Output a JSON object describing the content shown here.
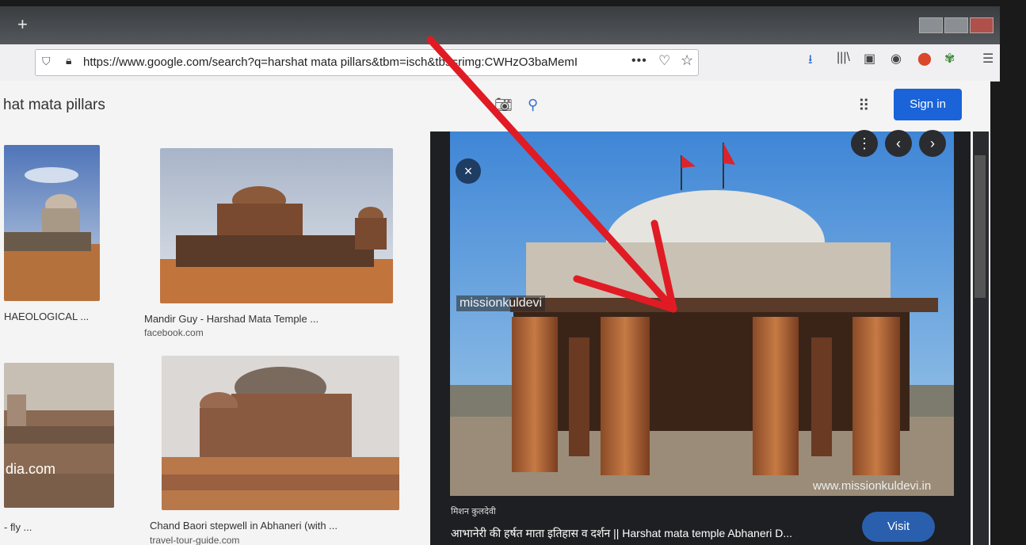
{
  "browser": {
    "new_tab_glyph": "+",
    "url": "https://www.google.com/search?q=harshat mata pillars&tbm=isch&tbs=rimg:CWHzO3baMemI",
    "more_glyph": "•••"
  },
  "google": {
    "query": "hat mata pillars",
    "sign_in_label": "Sign in"
  },
  "results": [
    {
      "caption": "HAEOLOGICAL ...",
      "source": ""
    },
    {
      "caption": "Mandir Guy - Harshad Mata Temple ...",
      "source": "facebook.com"
    },
    {
      "caption": "- fly ...",
      "source": ""
    },
    {
      "caption": "Chand Baori stepwell in Abhaneri (with ...",
      "source": "travel-tour-guide.com"
    }
  ],
  "thumb_overlay_text": "dia.com",
  "preview": {
    "watermark_top": "missionkuldevi",
    "watermark_bottom": "www.missionkuldevi.in",
    "source": "मिशन कुलदेवी",
    "title": "आभानेरी की हर्षत माता इतिहास व दर्शन || Harshat mata temple Abhaneri D...",
    "visit_label": "Visit"
  },
  "icons": {
    "close": "×",
    "more_vert": "⋮",
    "prev": "‹",
    "next": "›"
  },
  "colors": {
    "sign_in_blue": "#1a63d8",
    "arrow_red": "#e01b24",
    "panel_bg": "#1e1f22"
  }
}
